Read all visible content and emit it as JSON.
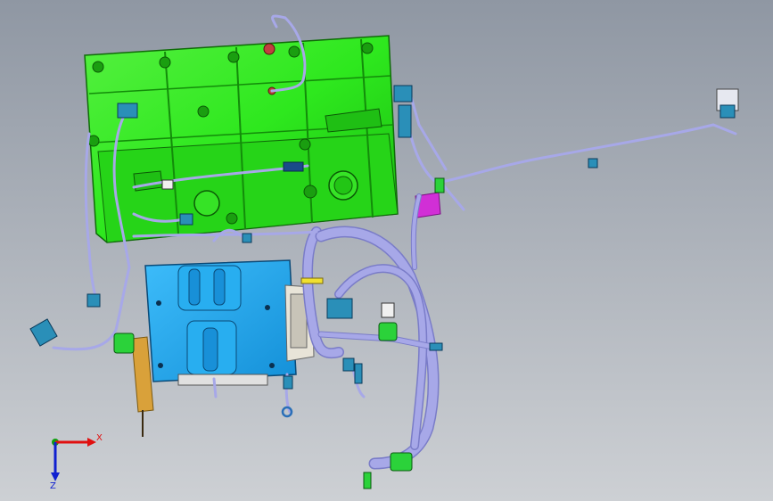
{
  "viewport": {
    "background_top": "#8f97a3",
    "background_bottom": "#cdd0d4"
  },
  "scene": {
    "parts": [
      {
        "name": "engine-block",
        "color": "#2ee81e"
      },
      {
        "name": "ecu-mounting-bracket",
        "color": "#1aa6f0"
      },
      {
        "name": "wire-harness",
        "color": "#a7a8e8"
      },
      {
        "name": "connectors",
        "color": "#2a8fb8"
      },
      {
        "name": "harness-clips",
        "color": "#2bd23a"
      },
      {
        "name": "relay-box",
        "color": "#d12fd6"
      },
      {
        "name": "bracket-plate",
        "color": "#d9a13a"
      }
    ]
  },
  "triad": {
    "x_label": "X",
    "z_label": "Z",
    "x_color": "#e01010",
    "y_color": "#10a010",
    "z_color": "#1020d0"
  }
}
